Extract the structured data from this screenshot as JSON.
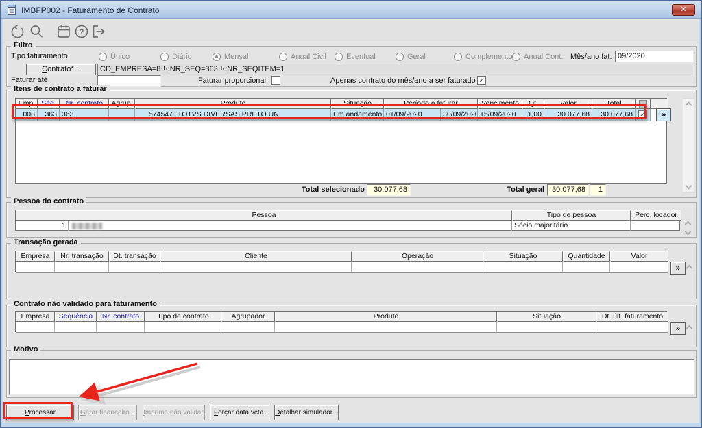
{
  "window": {
    "title": "IMBFP002 - Faturamento de Contrato",
    "close": "x"
  },
  "toolbar": {
    "icons": [
      "undo",
      "search",
      "calendar",
      "help",
      "exit"
    ]
  },
  "filtro": {
    "title": "Filtro",
    "tipo_label": "Tipo faturamento",
    "tipos": [
      {
        "label": "Único",
        "selected": false
      },
      {
        "label": "Diário",
        "selected": false
      },
      {
        "label": "Mensal",
        "selected": true
      },
      {
        "label": "Anual Civil",
        "selected": false
      },
      {
        "label": "Eventual",
        "selected": false
      },
      {
        "label": "Geral",
        "selected": false
      },
      {
        "label": "Complemento",
        "selected": false
      },
      {
        "label": "Anual Cont.",
        "selected": false
      }
    ],
    "mes_ano_label": "Mês/ano fat.",
    "mes_ano_value": "09/2020",
    "contrato_button": "Contrato*...",
    "contrato_value": "CD_EMPRESA=8·!·;NR_SEQ=363·!·;NR_SEQITEM=1",
    "faturar_ate_label": "Faturar até",
    "faturar_ate_value": "",
    "faturar_proporcional_label": "Faturar proporcional",
    "faturar_proporcional_checked": false,
    "apenas_label": "Apenas contrato do mês/ano a ser faturado",
    "apenas_checked": true
  },
  "itens": {
    "title": "Itens de contrato a faturar",
    "columns": [
      "Emp.",
      "Seq.",
      "Nr. contrato",
      "Agrup.",
      "Produto",
      "Situação",
      "Período a faturar",
      "Vencimento",
      "Qt.",
      "Valor",
      "Total"
    ],
    "row": {
      "emp": "008",
      "seq": "363",
      "nr_contrato": "363",
      "agrup": "",
      "produto_codigo": "574547",
      "produto_nome": "TOTVS DIVERSAS PRETO UN",
      "situacao": "Em andamento",
      "periodo_inicio": "01/09/2020",
      "periodo_fim": "30/09/2020",
      "vencimento": "15/09/2020",
      "qt": "1,00",
      "valor": "30.077,68",
      "total": "30.077,68",
      "selected": true
    },
    "expand": "»",
    "total_selecionado_label": "Total selecionado",
    "total_selecionado": "30.077,68",
    "total_geral_label": "Total geral",
    "total_geral": "30.077,68",
    "total_geral_qtd": "1"
  },
  "pessoa": {
    "title": "Pessoa do contrato",
    "col_pessoa": "Pessoa",
    "col_tipo": "Tipo de pessoa",
    "col_perc": "Perc. locador",
    "row": {
      "numero": "1",
      "nome_redigido": true,
      "tipo": "Sócio majoritário",
      "perc": ""
    }
  },
  "transacao": {
    "title": "Transação gerada",
    "columns": [
      "Empresa",
      "Nr. transação",
      "Dt. transação",
      "Cliente",
      "Operação",
      "Situação",
      "Quantidade",
      "Valor"
    ],
    "expand": "»"
  },
  "nao_validado": {
    "title": "Contrato não validado para faturamento",
    "columns": [
      "Empresa",
      "Sequência",
      "Nr. contrato",
      "Tipo de contrato",
      "Agrupador",
      "Produto",
      "Situação",
      "Dt. últ. faturamento"
    ],
    "expand": "»"
  },
  "motivo": {
    "title": "Motivo",
    "value": ""
  },
  "acoes": [
    {
      "label": "Processar",
      "enabled": true
    },
    {
      "label": "Gerar financeiro...",
      "enabled": false
    },
    {
      "label": "Imprime não validado",
      "enabled": false
    },
    {
      "label": "Forçar data vcto.",
      "enabled": true
    },
    {
      "label": "Detalhar simulador...",
      "enabled": true
    }
  ],
  "annotation_color": "#e8251d"
}
